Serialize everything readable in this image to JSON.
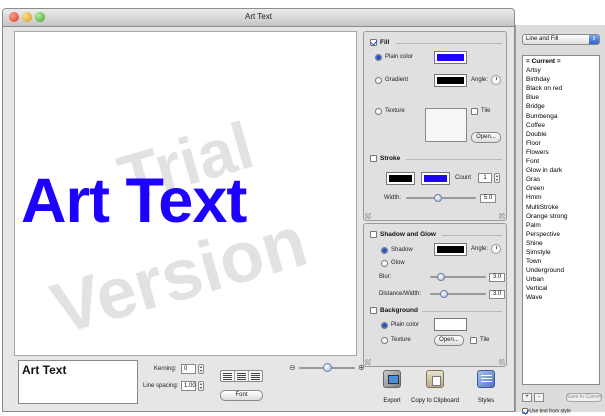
{
  "window": {
    "title": "Art Text"
  },
  "canvas": {
    "main_text": "Art Text",
    "watermark_line1": "Trial",
    "watermark_line2": "Version",
    "text_color": "#1d00ff"
  },
  "bottom": {
    "text_value": "Art Text",
    "kerning_label": "Kerning:",
    "kerning_value": "0",
    "line_spacing_label": "Line spacing:",
    "line_spacing_value": "1.00",
    "font_button": "Font"
  },
  "fill": {
    "title": "Fill",
    "enabled": true,
    "plain_color_label": "Plain color",
    "plain_color": "#1e00ff",
    "gradient_label": "Gradient",
    "gradient_color": "#000000",
    "angle_label": "Angle:",
    "texture_label": "Texture",
    "tile_label": "Tile",
    "open_button": "Open..."
  },
  "stroke": {
    "title": "Stroke",
    "color1": "#000000",
    "color2": "#1e00ff",
    "count_label": "Count",
    "count_value": "1",
    "width_label": "Width:",
    "width_value": "5.0",
    "width_level": 0.45
  },
  "shadow": {
    "title": "Shadow and Glow",
    "shadow_label": "Shadow",
    "glow_label": "Glow",
    "color": "#000000",
    "angle_label": "Angle:",
    "blur_label": "Blur:",
    "blur_value": "3.0",
    "blur_level": 0.15,
    "distance_label": "Distance/Width:",
    "distance_value": "3.0",
    "distance_level": 0.2
  },
  "background": {
    "title": "Background",
    "plain_color_label": "Plain color",
    "texture_label": "Texture",
    "open_button": "Open...",
    "tile_label": "Tile"
  },
  "toolbar": {
    "export_label": "Export",
    "copy_label": "Copy to Clipboard",
    "styles_label": "Styles"
  },
  "drawer": {
    "select_value": "Line and Fill",
    "styles": [
      "= Current =",
      "Artsy",
      "Birthday",
      "Black on red",
      "Blue",
      "Bridge",
      "Bumbenga",
      "Coffee",
      "Double",
      "Floor",
      "Flowers",
      "Font",
      "Glow in dark",
      "Gras",
      "Green",
      "Hmm",
      "MultiStroke",
      "Orange strong",
      "Palm",
      "Perspective",
      "Shine",
      "Simstyle",
      "Town",
      "Underground",
      "Urban",
      "Vertical",
      "Wave"
    ],
    "add_label": "+",
    "remove_label": "-",
    "save_button": "Save to Current",
    "use_text_label": "Use text from style"
  }
}
